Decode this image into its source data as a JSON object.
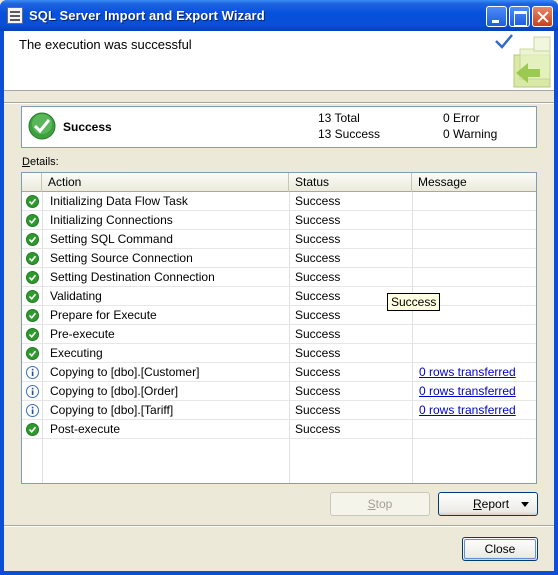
{
  "window": {
    "title": "SQL Server Import and Export Wizard"
  },
  "header": {
    "title": "The execution was successful"
  },
  "summary": {
    "status": "Success",
    "total": "13 Total",
    "success": "13 Success",
    "error": "0 Error",
    "warning": "0 Warning"
  },
  "details": {
    "label_prefix": "D",
    "label_rest": "etails:",
    "columns": [
      "Action",
      "Status",
      "Message"
    ],
    "rows": [
      {
        "icon": "success-icon",
        "action": "Initializing Data Flow Task",
        "status": "Success",
        "message": ""
      },
      {
        "icon": "success-icon",
        "action": "Initializing Connections",
        "status": "Success",
        "message": ""
      },
      {
        "icon": "success-icon",
        "action": "Setting SQL Command",
        "status": "Success",
        "message": ""
      },
      {
        "icon": "success-icon",
        "action": "Setting Source Connection",
        "status": "Success",
        "message": ""
      },
      {
        "icon": "success-icon",
        "action": "Setting Destination Connection",
        "status": "Success",
        "message": ""
      },
      {
        "icon": "success-icon",
        "action": "Validating",
        "status": "Success",
        "message": ""
      },
      {
        "icon": "success-icon",
        "action": "Prepare for Execute",
        "status": "Success",
        "message": ""
      },
      {
        "icon": "success-icon",
        "action": "Pre-execute",
        "status": "Success",
        "message": ""
      },
      {
        "icon": "success-icon",
        "action": "Executing",
        "status": "Success",
        "message": ""
      },
      {
        "icon": "info-icon",
        "action": "Copying to [dbo].[Customer]",
        "status": "Success",
        "message": "0 rows transferred"
      },
      {
        "icon": "info-icon",
        "action": "Copying to [dbo].[Order]",
        "status": "Success",
        "message": "0 rows transferred"
      },
      {
        "icon": "info-icon",
        "action": "Copying to [dbo].[Tariff]",
        "status": "Success",
        "message": "0 rows transferred"
      },
      {
        "icon": "success-icon",
        "action": "Post-execute",
        "status": "Success",
        "message": ""
      }
    ]
  },
  "tooltip": {
    "text": "Success"
  },
  "buttons": {
    "stop_key": "S",
    "stop_rest": "top",
    "report_key": "R",
    "report_rest": "eport",
    "close": "Close"
  },
  "colors": {
    "success": "#2e9a2e",
    "info": "#3a6fc4",
    "link": "#0000cc",
    "titlebar": "#0a4fd6"
  }
}
